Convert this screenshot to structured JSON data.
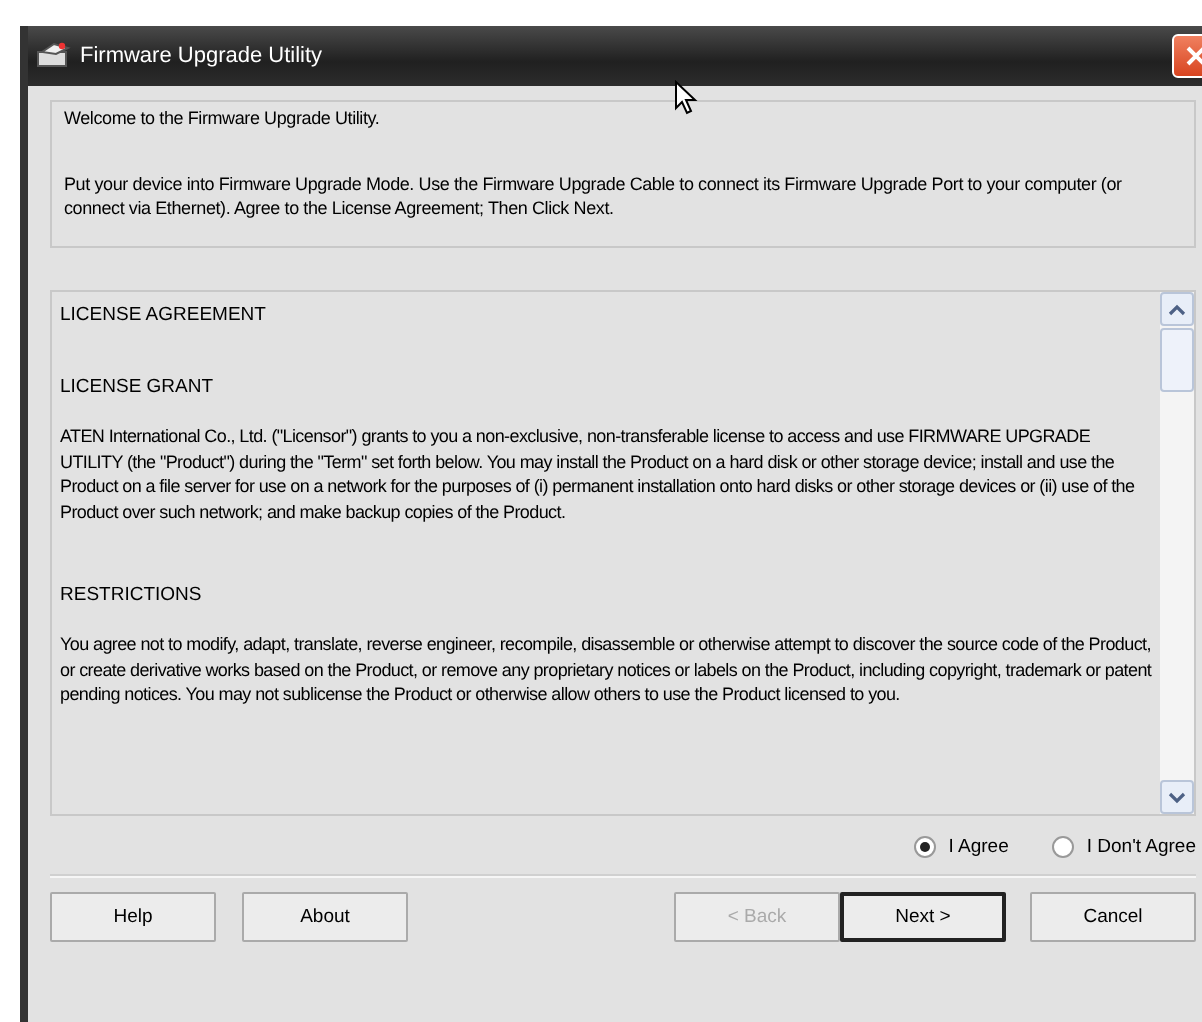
{
  "window": {
    "title": "Firmware Upgrade Utility"
  },
  "intro": [
    "Welcome to the Firmware Upgrade Utility.",
    "Put your device into Firmware Upgrade Mode. Use the Firmware Upgrade Cable to connect its Firmware Upgrade Port to your computer (or connect via Ethernet). Agree to the License Agreement; Then Click Next."
  ],
  "license": [
    {
      "kind": "heading",
      "text": "LICENSE AGREEMENT"
    },
    {
      "kind": "heading",
      "text": "LICENSE GRANT"
    },
    {
      "kind": "paragraph",
      "text": "ATEN International Co., Ltd. (\"Licensor\") grants to you a non-exclusive, non-transferable license to access and use FIRMWARE UPGRADE UTILITY (the \"Product\") during the \"Term\" set forth below. You may install the Product on a hard disk or other storage device; install and use the Product on a file server for use on a network for the purposes of (i) permanent installation onto hard disks or other storage devices or (ii) use of the Product over such network; and make backup copies of the Product."
    },
    {
      "kind": "heading",
      "text": "RESTRICTIONS"
    },
    {
      "kind": "paragraph",
      "text": "You agree not to modify, adapt, translate, reverse engineer, recompile, disassemble or otherwise attempt to discover the source code of the Product, or create derivative works based on the Product, or remove any proprietary notices or labels on the Product, including copyright, trademark or patent pending notices. You may not sublicense the Product or otherwise allow others to use the Product licensed to you."
    }
  ],
  "agreement": [
    {
      "label": "I Agree",
      "selected": true
    },
    {
      "label": "I Don't Agree",
      "selected": false
    }
  ],
  "buttons_left": [
    {
      "label": "Help"
    },
    {
      "label": "About"
    }
  ],
  "buttons_right": [
    {
      "label": "< Back",
      "disabled": true,
      "default": false
    },
    {
      "label": "Next >",
      "disabled": false,
      "default": true
    },
    {
      "label": "Cancel",
      "disabled": false,
      "default": false
    }
  ]
}
